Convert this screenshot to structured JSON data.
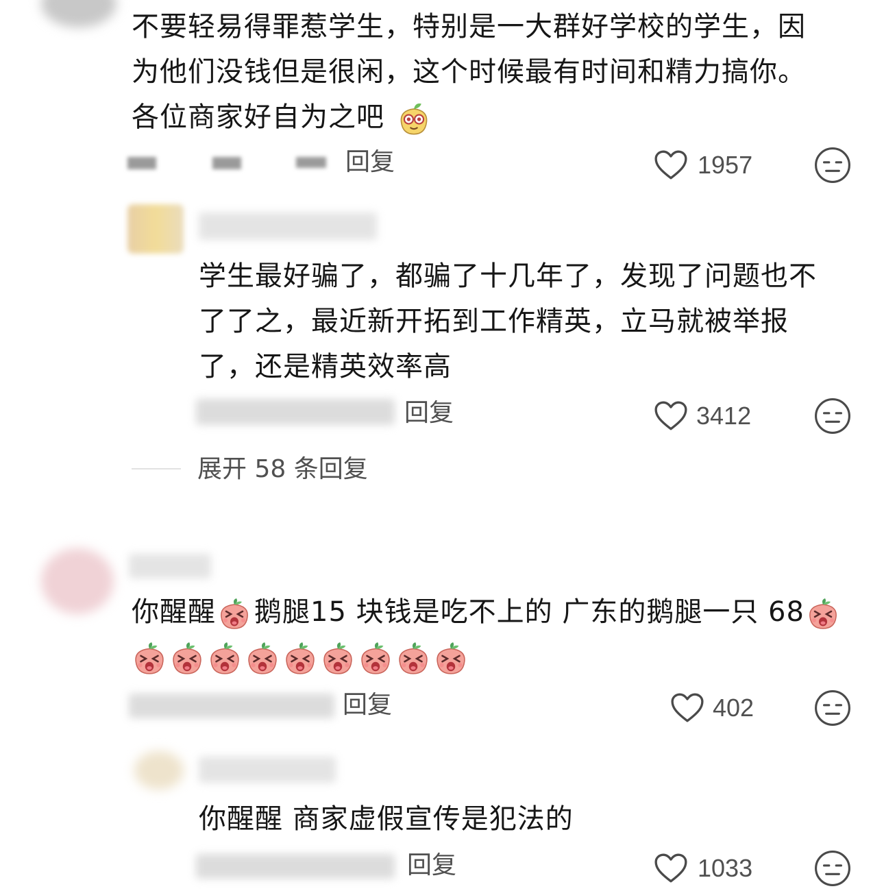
{
  "comments": [
    {
      "text_lines": [
        "不要轻易得罪惹学生，特别是一大群好学校的学生，因",
        "为他们没钱但是很闲，这个时候最有时间和精力搞你。",
        "各位商家好自为之吧"
      ],
      "reply_label": "回复",
      "likes": "1957"
    },
    {
      "text_lines": [
        "学生最好骗了，都骗了十几年了，发现了问题也不",
        "了了之，最近新开拓到工作精英，立马就被举报",
        "了，还是精英效率高"
      ],
      "reply_label": "回复",
      "likes": "3412",
      "expand_label": "展开 58 条回复"
    },
    {
      "text_line1a": "你醒醒",
      "text_line1b": "鹅腿15 块钱是吃不上的 广东的鹅腿一只 68",
      "reply_label": "回复",
      "likes": "402",
      "emoji_icon": "crying-peach-icon"
    },
    {
      "text_lines": [
        "你醒醒 商家虚假宣传是犯法的"
      ],
      "reply_label": "回复",
      "likes": "1033"
    }
  ],
  "icons": {
    "like": "heart-outline-icon",
    "dislike": "neutral-face-icon",
    "sticker": "mango-face-icon"
  },
  "colors": {
    "text": "#161616",
    "meta": "#505050",
    "icon": "#4a4a4a",
    "peach": "#f4a29a"
  }
}
